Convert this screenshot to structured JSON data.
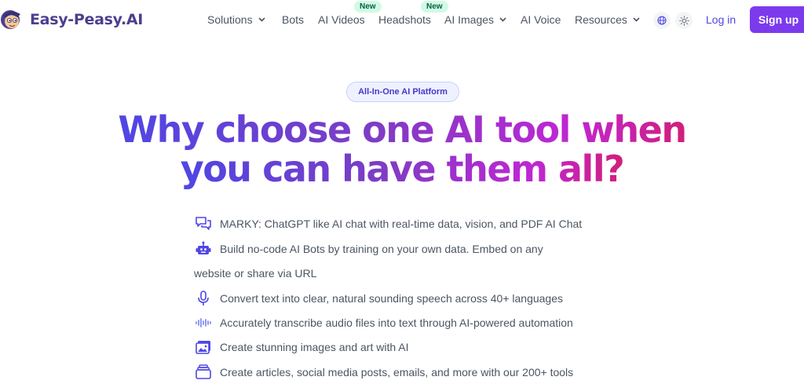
{
  "brand": {
    "name": "Easy-Peasy.AI"
  },
  "nav": {
    "items": [
      {
        "label": "Solutions",
        "dropdown": true
      },
      {
        "label": "Bots",
        "dropdown": false
      },
      {
        "label": "AI Videos",
        "dropdown": false,
        "badge": "New"
      },
      {
        "label": "Headshots",
        "dropdown": false,
        "badge": "New"
      },
      {
        "label": "AI Images",
        "dropdown": true
      },
      {
        "label": "AI Voice",
        "dropdown": false
      },
      {
        "label": "Resources",
        "dropdown": true
      }
    ],
    "icons": [
      "globe-icon",
      "sun-icon"
    ],
    "login": "Log in",
    "signup": "Sign up"
  },
  "hero": {
    "pill": "All-In-One AI Platform",
    "headline_line1": "Why choose one AI tool when",
    "headline_line2": "you can have them all?"
  },
  "features": [
    {
      "icon": "chat-icon",
      "text": "MARKY: ChatGPT like AI chat with real-time data, vision, and PDF AI Chat"
    },
    {
      "icon": "robot-icon",
      "text": "Build no-code AI Bots by training on your own data. Embed on any",
      "text_cont": "website or share via URL"
    },
    {
      "icon": "microphone-icon",
      "text": "Convert text into clear, natural sounding speech across 40+ languages"
    },
    {
      "icon": "soundwave-icon",
      "text": "Accurately transcribe audio files into text through AI-powered automation"
    },
    {
      "icon": "image-icon",
      "text": "Create stunning images and art with AI"
    },
    {
      "icon": "document-stack-icon",
      "text": "Create articles, social media posts, emails, and more with our 200+ tools"
    }
  ],
  "colors": {
    "accent": "#7c3aed",
    "link": "#4f46e5",
    "badge_bg": "#d1fae5",
    "badge_text": "#065f46",
    "pill_bg": "#eef2ff",
    "gradient_start": "#4f46e5",
    "gradient_end": "#d11f7a"
  }
}
